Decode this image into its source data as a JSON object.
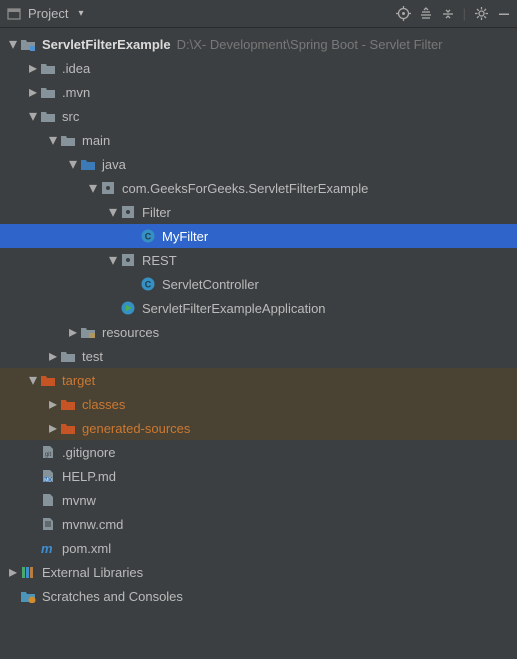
{
  "toolbar": {
    "title": "Project"
  },
  "root": {
    "name": "ServletFilterExample",
    "path": "D:\\X- Development\\Spring Boot - Servlet Filter"
  },
  "nodes": {
    "idea": ".idea",
    "mvn": ".mvn",
    "src": "src",
    "main": "main",
    "java": "java",
    "package": "com.GeeksForGeeks.ServletFilterExample",
    "filter": "Filter",
    "myfilter": "MyFilter",
    "rest": "REST",
    "servletcontroller": "ServletController",
    "app": "ServletFilterExampleApplication",
    "resources": "resources",
    "test": "test",
    "target": "target",
    "classes": "classes",
    "gensrc": "generated-sources",
    "gitignore": ".gitignore",
    "helpmd": "HELP.md",
    "mvnw": "mvnw",
    "mvnwcmd": "mvnw.cmd",
    "pom": "pom.xml",
    "extlib": "External Libraries",
    "scratches": "Scratches and Consoles"
  }
}
